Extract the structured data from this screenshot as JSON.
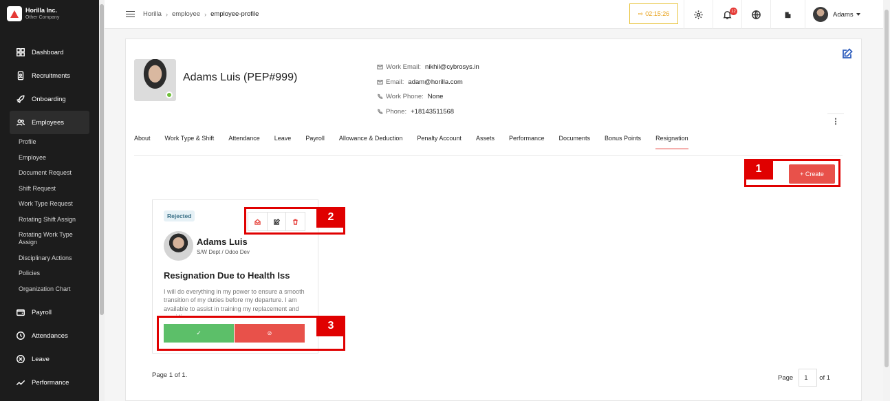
{
  "brand": {
    "name": "Horilla Inc.",
    "sub": "Other Company"
  },
  "sidebar": {
    "main_top": [
      {
        "label": "Dashboard",
        "icon": "dashboard-icon"
      },
      {
        "label": "Recruitments",
        "icon": "recruitment-icon"
      },
      {
        "label": "Onboarding",
        "icon": "rocket-icon"
      },
      {
        "label": "Employees",
        "icon": "people-icon"
      }
    ],
    "sub_items": [
      "Profile",
      "Employee",
      "Document Request",
      "Shift Request",
      "Work Type Request",
      "Rotating Shift Assign",
      "Rotating Work Type Assign",
      "Disciplinary Actions",
      "Policies",
      "Organization Chart"
    ],
    "main_bottom": [
      {
        "label": "Payroll",
        "icon": "wallet-icon"
      },
      {
        "label": "Attendances",
        "icon": "clock-icon"
      },
      {
        "label": "Leave",
        "icon": "leave-icon"
      },
      {
        "label": "Performance",
        "icon": "chart-icon"
      }
    ]
  },
  "header": {
    "breadcrumbs": [
      "Horilla",
      "employee",
      "employee-profile"
    ],
    "timer": "02:15:26",
    "notification_count": "12",
    "user_name": "Adams"
  },
  "profile": {
    "name": "Adams Luis (PEP#999)",
    "contact": [
      {
        "label": "Work Email:",
        "value": "nikhil@cybrosys.in",
        "icon": "mail-icon"
      },
      {
        "label": "Email:",
        "value": "adam@horilla.com",
        "icon": "mail-icon"
      },
      {
        "label": "Work Phone:",
        "value": "None",
        "icon": "phone-icon"
      },
      {
        "label": "Phone:",
        "value": "+18143511568",
        "icon": "phone-icon"
      }
    ],
    "tabs": [
      "About",
      "Work Type & Shift",
      "Attendance",
      "Leave",
      "Payroll",
      "Allowance & Deduction",
      "Penalty Account",
      "Assets",
      "Performance",
      "Documents",
      "Bonus Points",
      "Resignation"
    ],
    "active_tab": "Resignation"
  },
  "create_button": "+ Create",
  "resignation": {
    "status": "Rejected",
    "employee_name": "Adams Luis",
    "employee_dept": "S/W Dept / Odoo Dev",
    "title": "Resignation Due to Health Iss",
    "description": "I will do everything in my power to ensure a smooth transition of my duties before my departure. I am available to assist in training my replacement and providing any necessary"
  },
  "pagination": {
    "summary": "Page 1 of 1.",
    "label": "Page",
    "current": "1",
    "of": "of 1"
  },
  "annotations": [
    "1",
    "2",
    "3"
  ],
  "colors": {
    "accent": "#e8514a",
    "approve": "#5cbf69",
    "timer": "#e8a11a",
    "annotation": "#e00000"
  }
}
